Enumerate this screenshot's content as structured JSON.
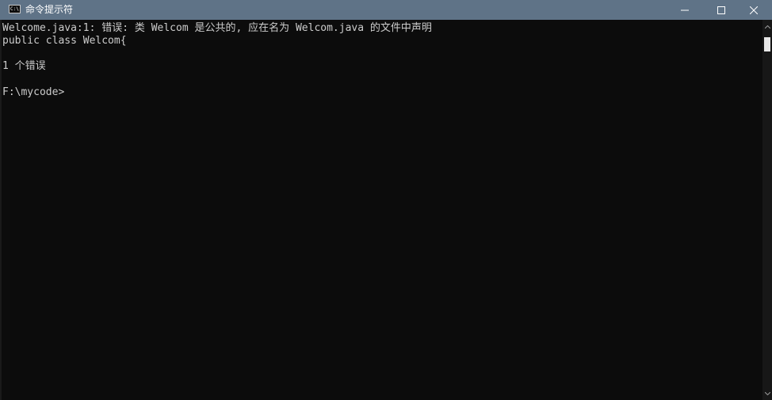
{
  "window": {
    "title": "命令提示符",
    "icon_text": "C:\\",
    "title_bg": "#5f7387",
    "console_bg": "#0c0c0c",
    "console_fg": "#cccccc"
  },
  "controls": {
    "minimize": "minimize-icon",
    "maximize": "maximize-icon",
    "close": "close-icon"
  },
  "console": {
    "lines": [
      "Welcome.java:1: 错误: 类 Welcom 是公共的, 应在名为 Welcom.java 的文件中声明",
      "public class Welcom{",
      "1 个错误",
      "F:\\mycode>"
    ]
  }
}
